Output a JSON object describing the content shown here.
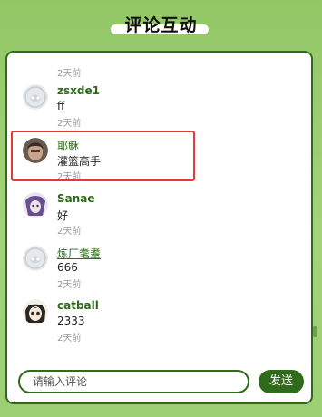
{
  "header": {
    "title": "评论互动"
  },
  "comments": [
    {
      "name": "",
      "content": "",
      "time": "2天前",
      "avatar": "partial"
    },
    {
      "name": "zsxde1",
      "content": "ff",
      "time": "2天前",
      "avatar": "default-avatar"
    },
    {
      "name": "耶稣",
      "content": "灌篮高手",
      "time": "2天前",
      "avatar": "photo-avatar",
      "highlighted": true
    },
    {
      "name": "Sanae",
      "content": "好",
      "time": "2天前",
      "avatar": "anime-avatar-purple"
    },
    {
      "name": "炼厂耄耋",
      "content": "666",
      "time": "2天前",
      "avatar": "default-avatar"
    },
    {
      "name": "catball",
      "content": "2333",
      "time": "2天前",
      "avatar": "anime-avatar-girl"
    }
  ],
  "composer": {
    "placeholder": "请输入评论",
    "send_label": "发送"
  },
  "colors": {
    "accent": "#2f6b1a",
    "highlight_border": "#e53935",
    "background": "#9ccf73"
  }
}
